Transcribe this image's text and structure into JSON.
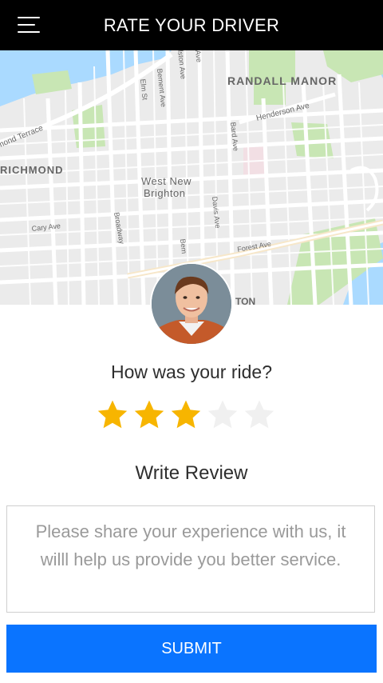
{
  "header": {
    "title": "RATE YOUR DRIVER",
    "menu_icon": "hamburger-menu-icon"
  },
  "map": {
    "labels": {
      "randall_manor": "RANDALL MANOR",
      "henderson_ave": "Henderson Ave",
      "richmond_terrace": "mond Terrace",
      "richmond": "RICHMOND",
      "west_new_brighton_1": "West New",
      "west_new_brighton_2": "Brighton",
      "cary_ave": "Cary Ave",
      "broadway": "Broadway",
      "elm_st": "Elm St",
      "bement_ave_top": "Bement Ave",
      "bement_ave_bottom": "Bem",
      "alston_ave": "lston Ave",
      "ave_top": "Ave",
      "bard_ave": "Bard Ave",
      "davis_ave": "Davis Ave",
      "forest_ave": "Forest Ave",
      "partial_label": "TON"
    },
    "colors": {
      "water": "#aadaff",
      "park": "#c8e6b4",
      "road": "#ffffff",
      "base": "#ebebeb",
      "highlight_road": "#f7e7c9"
    }
  },
  "driver": {
    "avatar_alt": "driver-avatar"
  },
  "rating": {
    "question": "How was your ride?",
    "value": 3,
    "max": 5,
    "filled_color": "#f7b500",
    "empty_color": "#f0f0f0"
  },
  "review": {
    "label": "Write Review",
    "placeholder": "Please share your experience with us, it willl help us provide you better service.",
    "value": ""
  },
  "actions": {
    "submit_label": "SUBMIT",
    "submit_color": "#0a74ff"
  }
}
